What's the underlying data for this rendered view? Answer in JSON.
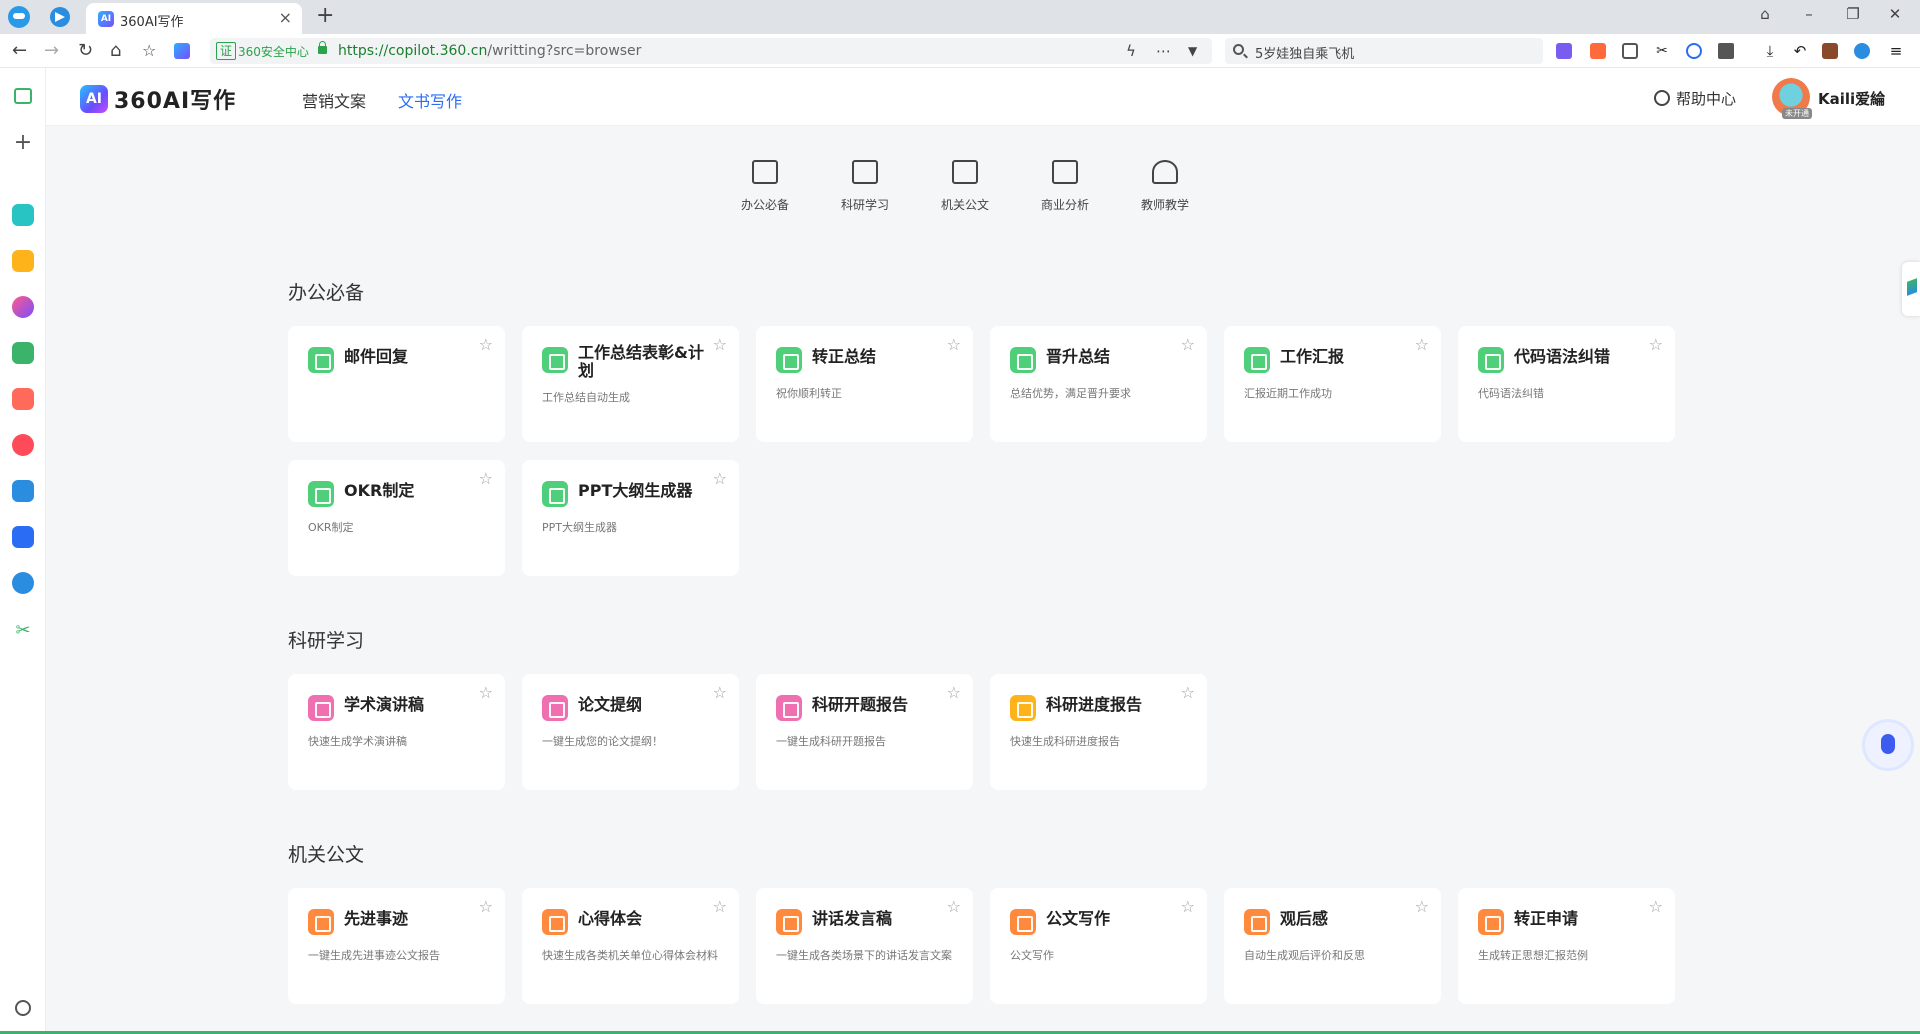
{
  "browser": {
    "tab_title": "360AI写作",
    "tab_favicon": "AI",
    "security_badge": "证",
    "security_text": "360安全中心",
    "url_prefix": "https://",
    "url_domain": "copilot.360.cn",
    "url_path": "/writting?src=browser",
    "search_text": "5岁娃独自乘飞机"
  },
  "app": {
    "logo_mark": "AI",
    "logo_text": "360AI写作",
    "nav": [
      "营销文案",
      "文书写作"
    ],
    "help_label": "帮助中心",
    "avatar_badge": "未开通",
    "username": "Kaili爱綸"
  },
  "categories": [
    "办公必备",
    "科研学习",
    "机关公文",
    "商业分析",
    "教师教学"
  ],
  "sections": [
    {
      "title": "办公必备",
      "cards": [
        {
          "title": "邮件回复",
          "desc": "",
          "color": "#4fcf7a"
        },
        {
          "title": "工作总结表彰&计划",
          "desc": "工作总结自动生成",
          "color": "#4fcf7a"
        },
        {
          "title": "转正总结",
          "desc": "祝你顺利转正",
          "color": "#4fcf7a"
        },
        {
          "title": "晋升总结",
          "desc": "总结优势，满足晋升要求",
          "color": "#4fcf7a"
        },
        {
          "title": "工作汇报",
          "desc": "汇报近期工作成功",
          "color": "#4fcf7a"
        },
        {
          "title": "代码语法纠错",
          "desc": "代码语法纠错",
          "color": "#4fcf7a"
        },
        {
          "title": "OKR制定",
          "desc": "OKR制定",
          "color": "#4fcf7a"
        },
        {
          "title": "PPT大纲生成器",
          "desc": "PPT大纲生成器",
          "color": "#4fcf7a"
        }
      ]
    },
    {
      "title": "科研学习",
      "cards": [
        {
          "title": "学术演讲稿",
          "desc": "快速生成学术演讲稿",
          "color": "#ef6fb0"
        },
        {
          "title": "论文提纲",
          "desc": "一键生成您的论文提纲！",
          "color": "#ef6fb0"
        },
        {
          "title": "科研开题报告",
          "desc": "一键生成科研开题报告",
          "color": "#ef6fb0"
        },
        {
          "title": "科研进度报告",
          "desc": "快速生成科研进度报告",
          "color": "#ffb31a"
        }
      ]
    },
    {
      "title": "机关公文",
      "cards": [
        {
          "title": "先进事迹",
          "desc": "一键生成先进事迹公文报告",
          "color": "#ff8a3d"
        },
        {
          "title": "心得体会",
          "desc": "快速生成各类机关单位心得体会材料",
          "color": "#ff8a3d"
        },
        {
          "title": "讲话发言稿",
          "desc": "一键生成各类场景下的讲话发言文案",
          "color": "#ff8a3d"
        },
        {
          "title": "公文写作",
          "desc": "公文写作",
          "color": "#ff8a3d"
        },
        {
          "title": "观后感",
          "desc": "自动生成观后评价和反思",
          "color": "#ff8a3d"
        },
        {
          "title": "转正申请",
          "desc": "生成转正思想汇报范例",
          "color": "#ff8a3d"
        }
      ]
    }
  ]
}
